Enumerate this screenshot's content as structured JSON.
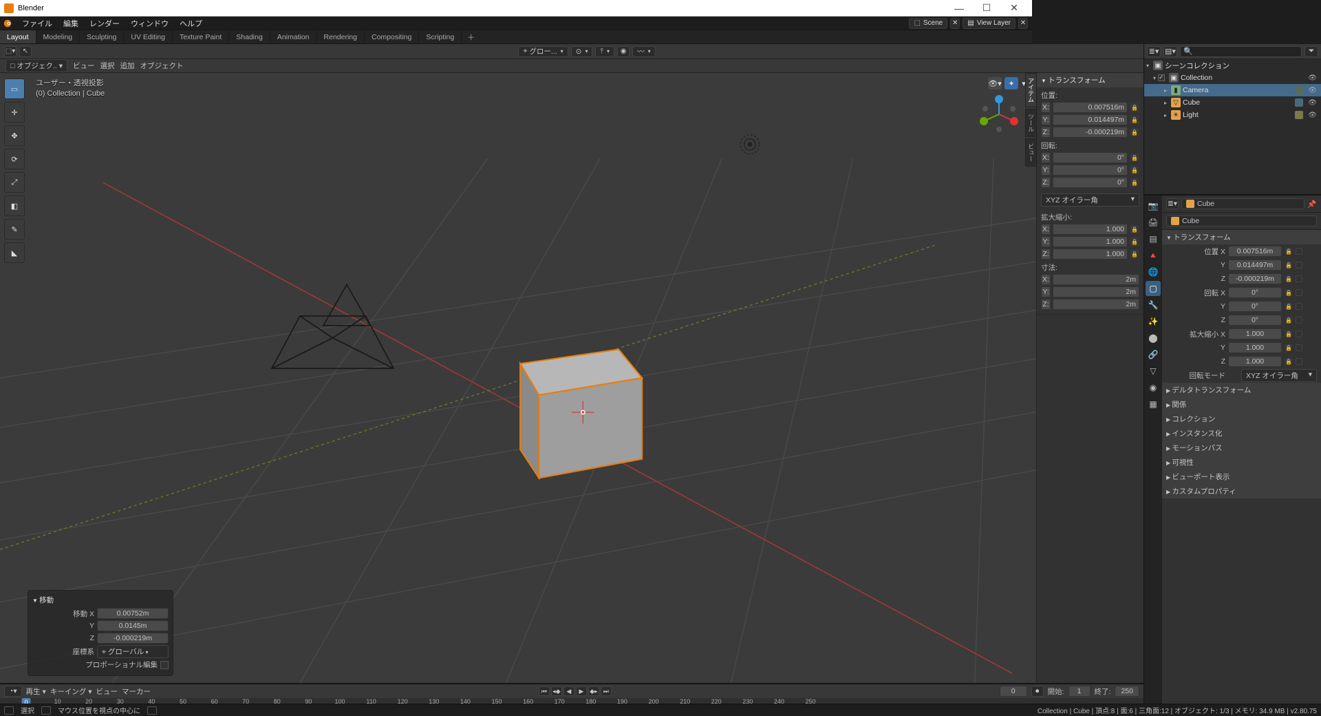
{
  "app": {
    "title": "Blender"
  },
  "menu": {
    "file": "ファイル",
    "edit": "編集",
    "render": "レンダー",
    "window": "ウィンドウ",
    "help": "ヘルプ",
    "scene_label": "Scene",
    "viewlayer_label": "View Layer"
  },
  "workspaces": [
    "Layout",
    "Modeling",
    "Sculpting",
    "UV Editing",
    "Texture Paint",
    "Shading",
    "Animation",
    "Rendering",
    "Compositing",
    "Scripting"
  ],
  "workspace_active": 0,
  "vphdr1": {
    "orientation": "グロー..."
  },
  "vphdr2": {
    "mode": "オブジェク..",
    "view": "ビュー",
    "select": "選択",
    "add": "追加",
    "object": "オブジェクト"
  },
  "viewport_info": {
    "l1": "ユーザー・透視投影",
    "l2": "(0) Collection | Cube"
  },
  "last_op": {
    "title": "移動",
    "move_x_label": "移動 X",
    "y_label": "Y",
    "z_label": "Z",
    "x": "0.00752m",
    "y": "0.0145m",
    "z": "-0.000219m",
    "orient_label": "座標系",
    "orient": "グローバル",
    "proportional_label": "プロポーショナル編集"
  },
  "npanel": {
    "title": "トランスフォーム",
    "loc_label": "位置:",
    "loc": {
      "x": "0.007516m",
      "y": "0.014497m",
      "z": "-0.000219m"
    },
    "rot_label": "回転:",
    "rot": {
      "x": "0°",
      "y": "0°",
      "z": "0°"
    },
    "rot_mode": "XYZ オイラー角",
    "scale_label": "拡大縮小:",
    "scale": {
      "x": "1.000",
      "y": "1.000",
      "z": "1.000"
    },
    "dim_label": "寸法:",
    "dim": {
      "x": "2m",
      "y": "2m",
      "z": "2m"
    },
    "tabs": [
      "アイテム",
      "ツール",
      "ビュー"
    ]
  },
  "outliner": {
    "title": "シーンコレクション",
    "collection": "Collection",
    "items": [
      {
        "name": "Camera",
        "type": "camera"
      },
      {
        "name": "Cube",
        "type": "mesh"
      },
      {
        "name": "Light",
        "type": "light"
      }
    ]
  },
  "props": {
    "breadcrumb1": "Cube",
    "breadcrumb2": "Cube",
    "transform_title": "トランスフォーム",
    "loc_label": "位置 X",
    "rot_label": "回転 X",
    "scale_label": "拡大縮小 X",
    "loc": {
      "x": "0.007516m",
      "y": "0.014497m",
      "z": "-0.000219m"
    },
    "rot": {
      "x": "0°",
      "y": "0°",
      "z": "0°"
    },
    "scale": {
      "x": "1.000",
      "y": "1.000",
      "z": "1.000"
    },
    "rotmode_label": "回転モード",
    "rotmode": "XYZ オイラー角",
    "sections": [
      "デルタトランスフォーム",
      "関係",
      "コレクション",
      "インスタンス化",
      "モーションパス",
      "可視性",
      "ビューポート表示",
      "カスタムプロパティ"
    ]
  },
  "timeline": {
    "play": "再生",
    "keying": "キーイング",
    "view": "ビュー",
    "marker": "マーカー",
    "current": "0",
    "start_label": "開始:",
    "start": "1",
    "end_label": "終了:",
    "end": "250",
    "ticks": [
      0,
      10,
      20,
      30,
      40,
      50,
      60,
      70,
      80,
      90,
      100,
      110,
      120,
      130,
      140,
      150,
      160,
      170,
      180,
      190,
      200,
      210,
      220,
      230,
      240,
      250
    ]
  },
  "status": {
    "left1": "選択",
    "left2": "マウス位置を視点の中心に",
    "right": "Collection | Cube | 頂点:8 | 面:6 | 三角面:12 | オブジェクト: 1/3 | メモリ: 34.9 MB | v2.80.75"
  }
}
